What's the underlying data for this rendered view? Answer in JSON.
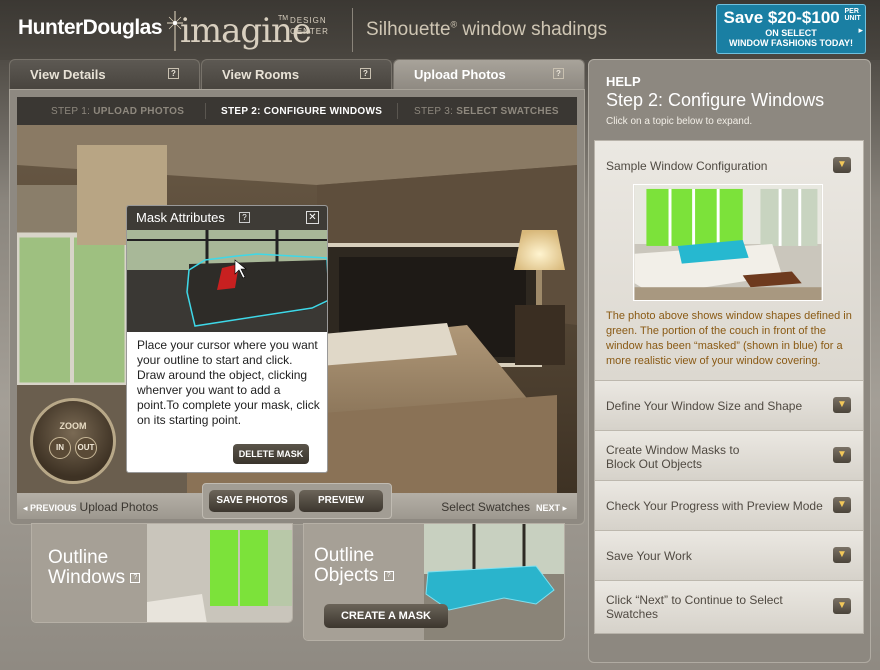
{
  "header": {
    "brand": "HunterDouglas",
    "imagine": "imagine",
    "tm": "TM",
    "design_center_1": "DESIGN",
    "design_center_2": "CENTER",
    "product": "Silhouette",
    "product_reg": "®",
    "product_rest": " window shadings",
    "promo_line1": "Save $20-$100",
    "promo_per_unit": "PER UNIT",
    "promo_line2": "ON SELECT",
    "promo_line3": "WINDOW FASHIONS TODAY!"
  },
  "tabs": [
    {
      "label": "View Details"
    },
    {
      "label": "View Rooms"
    },
    {
      "label": "Upload Photos"
    }
  ],
  "steps": {
    "step1_prefix": "STEP 1: ",
    "step1_label": "UPLOAD PHOTOS",
    "step2": "STEP 2: CONFIGURE WINDOWS",
    "step3_prefix": "STEP 3: ",
    "step3_label": "SELECT SWATCHES"
  },
  "zoom": {
    "label": "ZOOM",
    "in": "IN",
    "out": "OUT"
  },
  "mask_popup": {
    "title": "Mask Attributes",
    "help": "?",
    "close": "✕",
    "instructions": "Place your cursor where you want your outline to start and click. Draw around the object, clicking whenver you want to add a point.To complete your mask, click on its starting point.",
    "delete_label": "DELETE MASK"
  },
  "nav": {
    "prev_label": "◂ PREVIOUS",
    "prev_text": "Upload Photos",
    "next_text": "Select Swatches",
    "next_label": "NEXT ▸",
    "save_photos": "SAVE PHOTOS",
    "preview": "PREVIEW"
  },
  "cards": {
    "outline_windows_1": "Outline",
    "outline_windows_2": "Windows",
    "outline_objects_1": "Outline",
    "outline_objects_2": "Objects",
    "create_mask": "CREATE A MASK"
  },
  "help": {
    "label": "HELP",
    "title": "Step 2: Configure Windows",
    "subtitle": "Click on a topic below to expand.",
    "sample_title": "Sample Window Configuration",
    "sample_text": "The photo above shows window shapes defined in green. The portion of the couch in front of the window has been “masked” (shown in blue) for a more realistic view of your window covering.",
    "items": [
      {
        "label": "Define Your Window Size and Shape"
      },
      {
        "label": "Create Window Masks to\nBlock Out Objects"
      },
      {
        "label": "Check Your Progress with Preview Mode"
      },
      {
        "label": "Save Your Work"
      },
      {
        "label": "Click “Next” to Continue to Select\nSwatches"
      }
    ]
  },
  "colors": {
    "accent_teal": "#1a7fa3",
    "window_green": "#7ce23a",
    "mask_blue": "#26b8d0",
    "help_text_brown": "#8a5a14"
  }
}
